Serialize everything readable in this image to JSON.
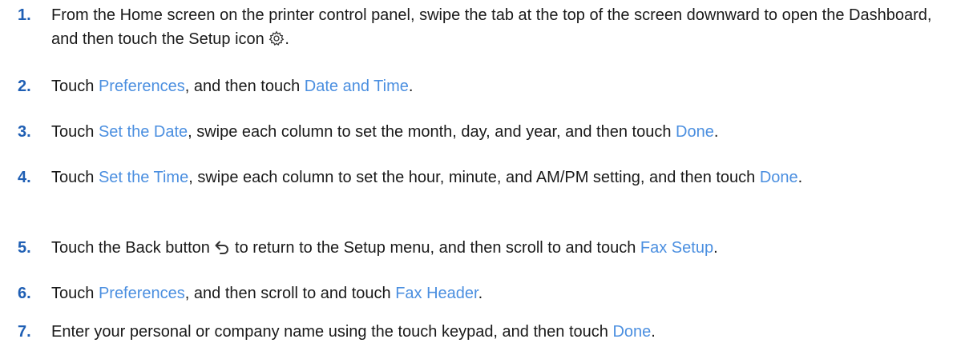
{
  "steps": [
    {
      "number": "1.",
      "parts": {
        "a": "From the Home screen on the printer control panel, swipe the tab at the top of the screen downward to open the Dashboard, and then touch the Setup icon",
        "b": "."
      },
      "icon": "gear-icon"
    },
    {
      "number": "2.",
      "parts": {
        "a": "Touch ",
        "link1": "Preferences",
        "b": ", and then touch ",
        "link2": "Date and Time",
        "c": "."
      }
    },
    {
      "number": "3.",
      "parts": {
        "a": "Touch ",
        "link1": "Set the Date",
        "b": ", swipe each column to set the month, day, and year, and then touch ",
        "link2": "Done",
        "c": "."
      }
    },
    {
      "number": "4.",
      "parts": {
        "a": "Touch ",
        "link1": "Set the Time",
        "b": ", swipe each column to set the hour, minute, and AM/PM setting, and then touch ",
        "link2": "Done",
        "c": "."
      }
    },
    {
      "number": "5.",
      "parts": {
        "a": "Touch the Back button ",
        "b": " to return to the Setup menu, and then scroll to and touch ",
        "link1": "Fax Setup",
        "c": "."
      },
      "icon": "back-arrow-icon"
    },
    {
      "number": "6.",
      "parts": {
        "a": "Touch ",
        "link1": "Preferences",
        "b": ", and then scroll to and touch ",
        "link2": "Fax Header",
        "c": "."
      }
    },
    {
      "number": "7.",
      "parts": {
        "a": "Enter your personal or company name using the touch keypad, and then touch ",
        "link1": "Done",
        "b": "."
      }
    }
  ],
  "colors": {
    "number": "#1f5fb4",
    "link": "#4b8fe0",
    "text": "#1a1a1a"
  }
}
